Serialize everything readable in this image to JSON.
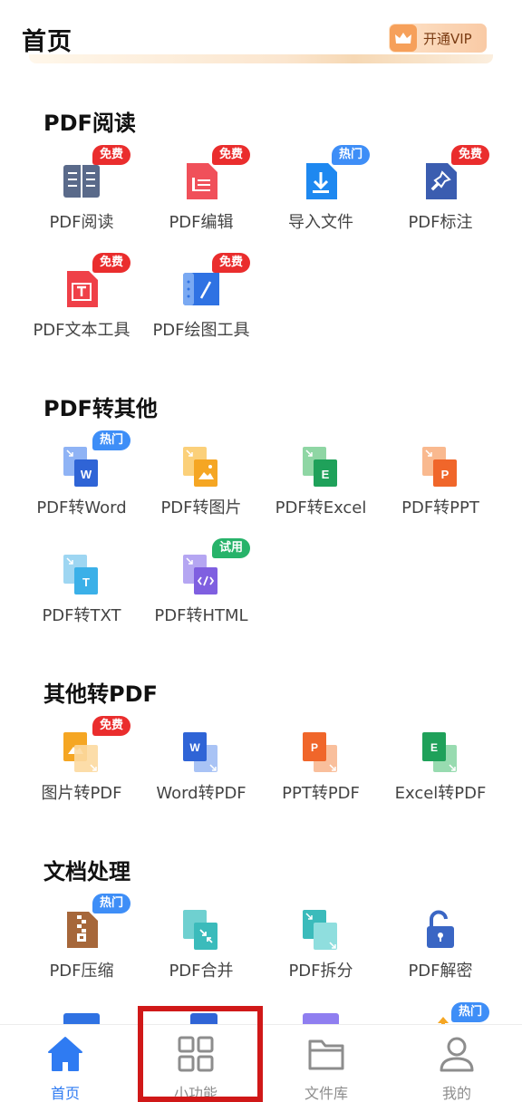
{
  "header": {
    "title": "首页",
    "vip_label": "开通VIP"
  },
  "sections": [
    {
      "title": "PDF阅读",
      "items": [
        {
          "label": "PDF阅读",
          "icon": "open-book-icon",
          "badge": "免费",
          "badge_color": "red"
        },
        {
          "label": "PDF编辑",
          "icon": "edit-document-icon",
          "badge": "免费",
          "badge_color": "red"
        },
        {
          "label": "导入文件",
          "icon": "import-file-icon",
          "badge": "热门",
          "badge_color": "blue"
        },
        {
          "label": "PDF标注",
          "icon": "pin-annotate-icon",
          "badge": "免费",
          "badge_color": "red"
        },
        {
          "label": "PDF文本工具",
          "icon": "text-tool-icon",
          "badge": "免费",
          "badge_color": "red"
        },
        {
          "label": "PDF绘图工具",
          "icon": "draw-tool-icon",
          "badge": "免费",
          "badge_color": "red"
        }
      ]
    },
    {
      "title": "PDF转其他",
      "items": [
        {
          "label": "PDF转Word",
          "icon": "pdf-to-word-icon",
          "badge": "热门",
          "badge_color": "blue"
        },
        {
          "label": "PDF转图片",
          "icon": "pdf-to-image-icon",
          "badge": "",
          "badge_color": ""
        },
        {
          "label": "PDF转Excel",
          "icon": "pdf-to-excel-icon",
          "badge": "",
          "badge_color": ""
        },
        {
          "label": "PDF转PPT",
          "icon": "pdf-to-ppt-icon",
          "badge": "",
          "badge_color": ""
        },
        {
          "label": "PDF转TXT",
          "icon": "pdf-to-txt-icon",
          "badge": "",
          "badge_color": ""
        },
        {
          "label": "PDF转HTML",
          "icon": "pdf-to-html-icon",
          "badge": "试用",
          "badge_color": "green"
        }
      ]
    },
    {
      "title": "其他转PDF",
      "items": [
        {
          "label": "图片转PDF",
          "icon": "image-to-pdf-icon",
          "badge": "免费",
          "badge_color": "red"
        },
        {
          "label": "Word转PDF",
          "icon": "word-to-pdf-icon",
          "badge": "",
          "badge_color": ""
        },
        {
          "label": "PPT转PDF",
          "icon": "ppt-to-pdf-icon",
          "badge": "",
          "badge_color": ""
        },
        {
          "label": "Excel转PDF",
          "icon": "excel-to-pdf-icon",
          "badge": "",
          "badge_color": ""
        }
      ]
    },
    {
      "title": "文档处理",
      "items": [
        {
          "label": "PDF压缩",
          "icon": "zip-compress-icon",
          "badge": "热门",
          "badge_color": "blue"
        },
        {
          "label": "PDF合并",
          "icon": "merge-icon",
          "badge": "",
          "badge_color": ""
        },
        {
          "label": "PDF拆分",
          "icon": "split-icon",
          "badge": "",
          "badge_color": ""
        },
        {
          "label": "PDF解密",
          "icon": "unlock-icon",
          "badge": "",
          "badge_color": ""
        }
      ]
    }
  ],
  "partial_row_badge": "热门",
  "tabbar": {
    "tabs": [
      {
        "label": "首页",
        "icon": "home-icon",
        "active": true
      },
      {
        "label": "小功能",
        "icon": "grid-icon",
        "active": false
      },
      {
        "label": "文件库",
        "icon": "folder-icon",
        "active": false
      },
      {
        "label": "我的",
        "icon": "person-icon",
        "active": false
      }
    ]
  },
  "colors": {
    "accent": "#2f7bf2",
    "badge_red": "#ea2d2d",
    "badge_blue": "#3e8ef7",
    "badge_green": "#27b36a",
    "highlight": "#d01818"
  }
}
